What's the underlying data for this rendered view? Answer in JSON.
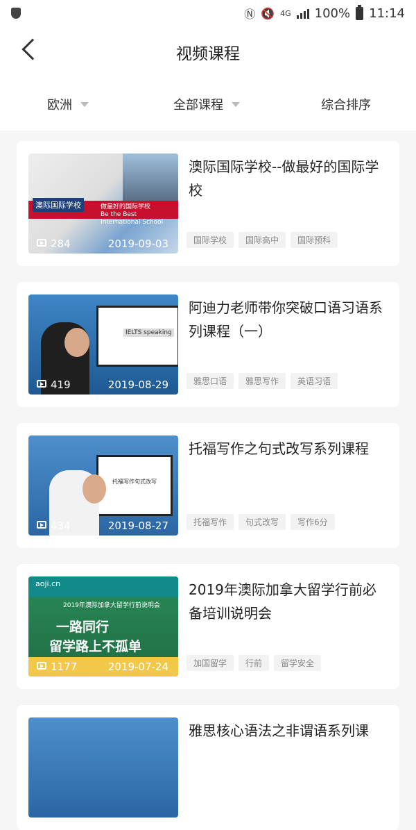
{
  "status": {
    "network": "4G",
    "battery": "100%",
    "time": "11:14"
  },
  "nav": {
    "title": "视频课程"
  },
  "filters": {
    "region": "欧洲",
    "course": "全部课程",
    "sort": "综合排序"
  },
  "courses": [
    {
      "title": "澳际国际学校--做最好的国际学校",
      "views": "284",
      "date": "2019-09-03",
      "tags": [
        "国际学校",
        "国际高中",
        "国际预科"
      ],
      "thumb_text": {
        "logo": "澳际国际学校",
        "slogan1": "做最好的国际学校",
        "slogan2": "Be the Best International School"
      }
    },
    {
      "title": "阿迪力老师带你突破口语习语系列课程（一）",
      "views": "419",
      "date": "2019-08-29",
      "tags": [
        "雅思口语",
        "雅思写作",
        "英语习语"
      ],
      "thumb_text": {
        "screen": "IELTS speaking"
      }
    },
    {
      "title": "托福写作之句式改写系列课程",
      "views": "434",
      "date": "2019-08-27",
      "tags": [
        "托福写作",
        "句式改写",
        "写作6分"
      ],
      "thumb_text": {
        "screen": "托福写作句式改写"
      }
    },
    {
      "title": "2019年澳际加拿大留学行前必备培训说明会",
      "views": "1177",
      "date": "2019-07-24",
      "tags": [
        "加国留学",
        "行前",
        "留学安全"
      ],
      "thumb_text": {
        "brand": "aoji.cn",
        "sub": "2019年澳际加拿大留学行前说明会",
        "line1": "一路同行",
        "line2": "留学路上不孤单"
      }
    },
    {
      "title": "雅思核心语法之非谓语系列课",
      "views": "",
      "date": "",
      "tags": []
    }
  ]
}
